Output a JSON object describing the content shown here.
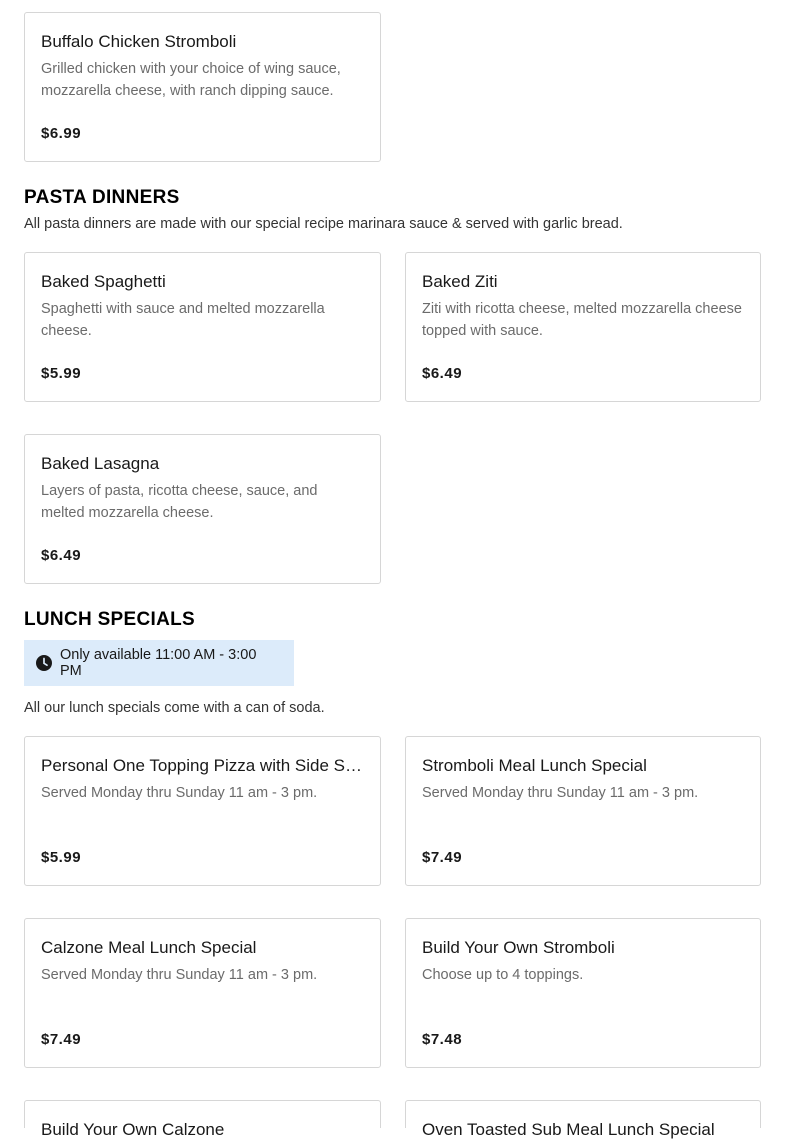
{
  "stromboli_section": {
    "items": [
      {
        "name": "Buffalo Chicken Stromboli",
        "desc": "Grilled chicken with your choice of wing sauce, mozzarella cheese, with ranch dipping sauce.",
        "price": "$6.99"
      }
    ]
  },
  "pasta": {
    "title": "PASTA DINNERS",
    "note": "All pasta dinners are made with our special recipe marinara sauce & served with garlic bread.",
    "items": [
      {
        "name": "Baked Spaghetti",
        "desc": "Spaghetti with sauce and melted mozzarella cheese.",
        "price": "$5.99"
      },
      {
        "name": "Baked Ziti",
        "desc": "Ziti with ricotta cheese, melted mozzarella cheese topped with sauce.",
        "price": "$6.49"
      },
      {
        "name": "Baked Lasagna",
        "desc": "Layers of pasta, ricotta cheese, sauce, and melted mozzarella cheese.",
        "price": "$6.49"
      }
    ]
  },
  "lunch": {
    "title": "LUNCH SPECIALS",
    "availability": "Only available 11:00 AM - 3:00 PM",
    "note": "All our lunch specials come with a can of soda.",
    "items": [
      {
        "name": "Personal One Topping Pizza with Side Salad",
        "desc": "Served Monday thru Sunday 11 am - 3 pm.",
        "price": "$5.99"
      },
      {
        "name": "Stromboli Meal Lunch Special",
        "desc": "Served Monday thru Sunday 11 am - 3 pm.",
        "price": "$7.49"
      },
      {
        "name": "Calzone Meal Lunch Special",
        "desc": "Served Monday thru Sunday 11 am - 3 pm.",
        "price": "$7.49"
      },
      {
        "name": "Build Your Own Stromboli",
        "desc": "Choose up to 4 toppings.",
        "price": "$7.48"
      },
      {
        "name": "Build Your Own Calzone",
        "desc": "",
        "price": ""
      },
      {
        "name": "Oven Toasted Sub Meal Lunch Special",
        "desc": "",
        "price": ""
      }
    ]
  },
  "icons": {
    "availability": "clock-icon"
  }
}
